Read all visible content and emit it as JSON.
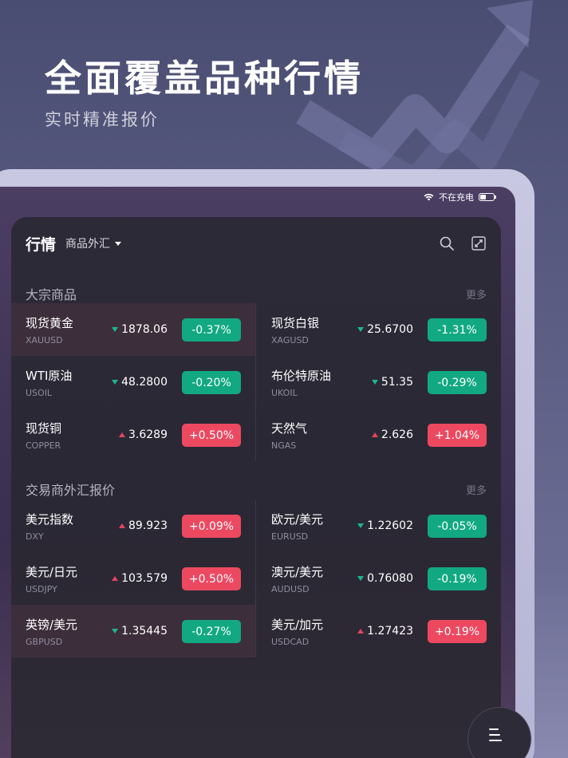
{
  "hero": {
    "title": "全面覆盖品种行情",
    "subtitle": "实时精准报价"
  },
  "status_bar": {
    "wifi_icon": "wifi-icon",
    "text": "不在充电",
    "battery_icon": "battery-icon"
  },
  "header": {
    "title": "行情",
    "filter_label": "商品外汇",
    "search_icon": "search-icon",
    "expand_icon": "expand-icon"
  },
  "sections": [
    {
      "title": "大宗商品",
      "more": "更多",
      "items": [
        {
          "name": "现货黄金",
          "code": "XAUUSD",
          "price": "1878.06",
          "direction": "down",
          "change": "-0.37%",
          "highlight": true
        },
        {
          "name": "现货白银",
          "code": "XAGUSD",
          "price": "25.6700",
          "direction": "down",
          "change": "-1.31%",
          "highlight": false
        },
        {
          "name": "WTI原油",
          "code": "USOIL",
          "price": "48.2800",
          "direction": "down",
          "change": "-0.20%",
          "highlight": false
        },
        {
          "name": "布伦特原油",
          "code": "UKOIL",
          "price": "51.35",
          "direction": "down",
          "change": "-0.29%",
          "highlight": false
        },
        {
          "name": "现货铜",
          "code": "COPPER",
          "price": "3.6289",
          "direction": "up",
          "change": "+0.50%",
          "highlight": false
        },
        {
          "name": "天然气",
          "code": "NGAS",
          "price": "2.626",
          "direction": "up",
          "change": "+1.04%",
          "highlight": false
        }
      ]
    },
    {
      "title": "交易商外汇报价",
      "more": "更多",
      "items": [
        {
          "name": "美元指数",
          "code": "DXY",
          "price": "89.923",
          "direction": "up",
          "change": "+0.09%",
          "highlight": false
        },
        {
          "name": "欧元/美元",
          "code": "EURUSD",
          "price": "1.22602",
          "direction": "down",
          "change": "-0.05%",
          "highlight": false
        },
        {
          "name": "美元/日元",
          "code": "USDJPY",
          "price": "103.579",
          "direction": "up",
          "change": "+0.50%",
          "highlight": false
        },
        {
          "name": "澳元/美元",
          "code": "AUDUSD",
          "price": "0.76080",
          "direction": "down",
          "change": "-0.19%",
          "highlight": false
        },
        {
          "name": "英镑/美元",
          "code": "GBPUSD",
          "price": "1.35445",
          "direction": "down",
          "change": "-0.27%",
          "highlight": true
        },
        {
          "name": "美元/加元",
          "code": "USDCAD",
          "price": "1.27423",
          "direction": "up",
          "change": "+0.19%",
          "highlight": false
        }
      ]
    }
  ],
  "colors": {
    "up": "#ec4961",
    "down": "#12a982",
    "panel_bg": "#2c2a37"
  },
  "fab": {
    "icon": "menu-icon"
  }
}
